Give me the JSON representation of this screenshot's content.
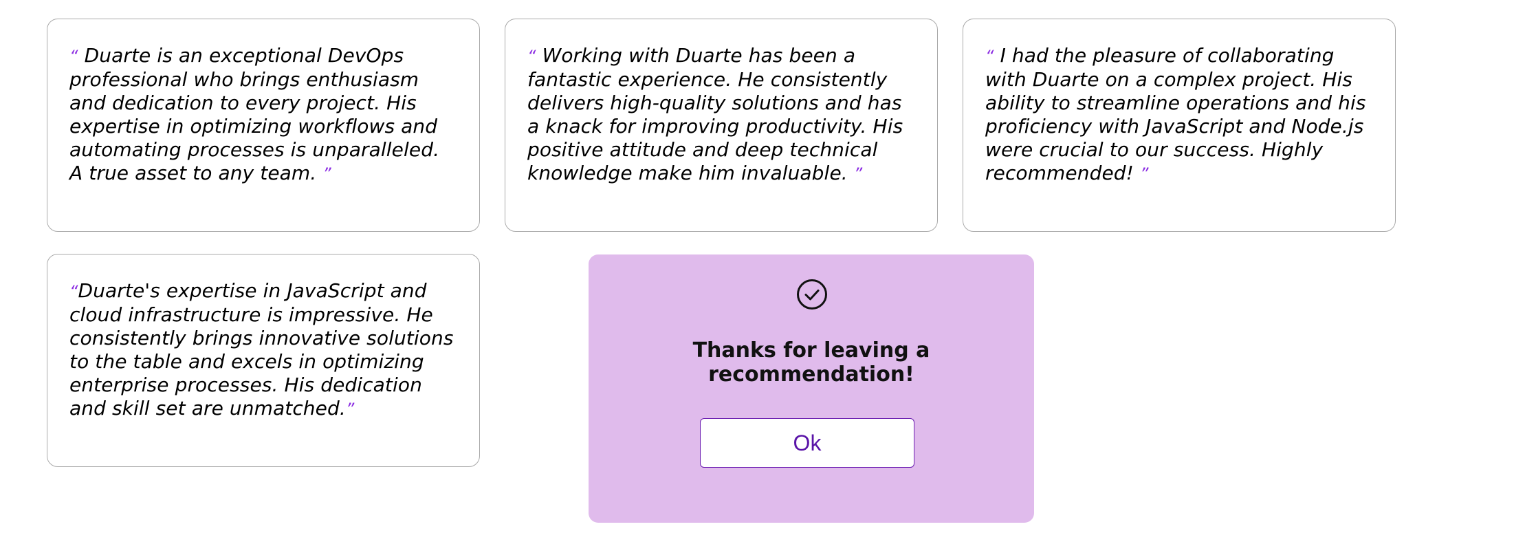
{
  "testimonials": [
    {
      "open_quote": "“",
      "text": "Duarte is an exceptional DevOps professional who brings enthusiasm and dedication to every project. His expertise in optimizing workflows and automating processes is unparalleled. A true asset to any team.",
      "close_quote": "”"
    },
    {
      "open_quote": "“",
      "text": "Working with Duarte has been a fantastic experience. He consistently delivers high-quality solutions and has a knack for improving productivity. His positive attitude and deep technical knowledge make him invaluable.",
      "close_quote": "”"
    },
    {
      "open_quote": "“",
      "text": "I had the pleasure of collaborating with Duarte on a complex project. His ability to streamline operations and his proficiency with JavaScript and Node.js were crucial to our success. Highly recommended!",
      "close_quote": "”"
    },
    {
      "open_quote": "“",
      "text": "Duarte's expertise in JavaScript and cloud infrastructure is impressive. He consistently brings innovative solutions to the table and excels in optimizing enterprise processes. His dedication and skill set are unmatched.",
      "close_quote": "”"
    }
  ],
  "modal": {
    "icon": "check-circle-icon",
    "message": "Thanks for leaving a recommendation!",
    "ok_label": "Ok"
  },
  "colors": {
    "quote_mark": "#8a2be2",
    "modal_background": "#e0bbec",
    "button_text": "#5a14a8",
    "card_border": "#a9a9a9"
  }
}
